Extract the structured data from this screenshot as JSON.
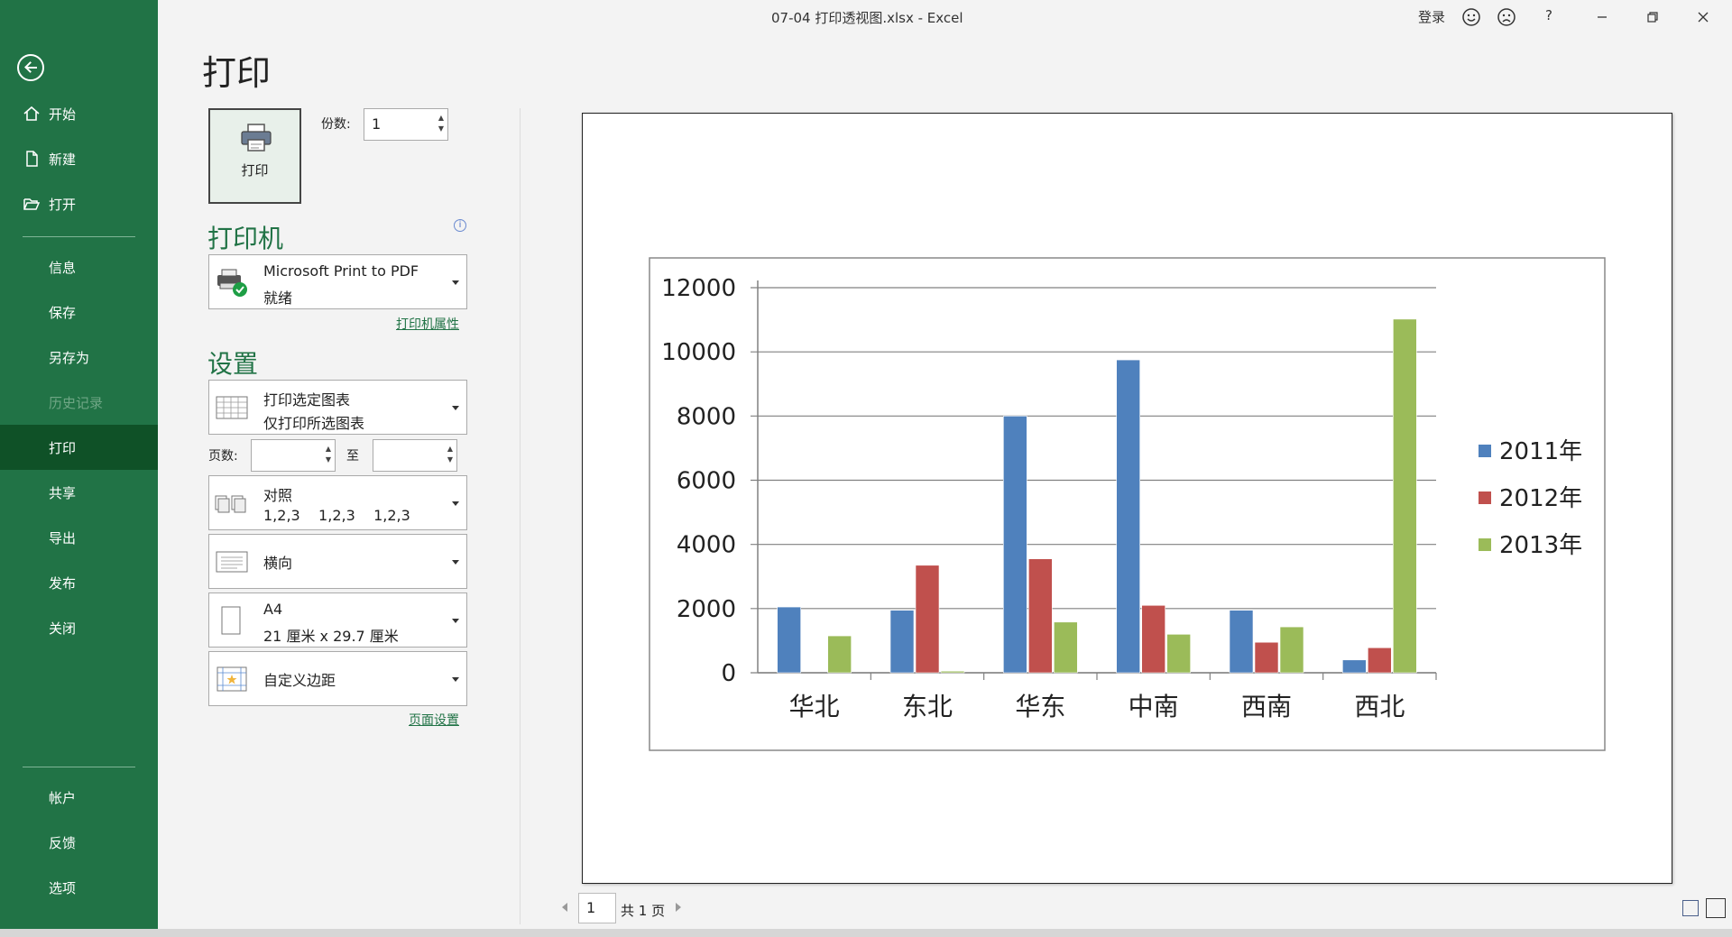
{
  "window": {
    "title": "07-04 打印透视图.xlsx  -  Excel",
    "signin_label": "登录",
    "help_label": "?"
  },
  "sidebar": {
    "items": [
      {
        "label": "开始",
        "icon": "home-icon"
      },
      {
        "label": "新建",
        "icon": "new-document-icon"
      },
      {
        "label": "打开",
        "icon": "open-folder-icon"
      },
      {
        "label": "信息"
      },
      {
        "label": "保存"
      },
      {
        "label": "另存为"
      },
      {
        "label": "历史记录",
        "disabled": true
      },
      {
        "label": "打印",
        "active": true
      },
      {
        "label": "共享"
      },
      {
        "label": "导出"
      },
      {
        "label": "发布"
      },
      {
        "label": "关闭"
      },
      {
        "label": "帐户"
      },
      {
        "label": "反馈"
      },
      {
        "label": "选项"
      }
    ]
  },
  "print": {
    "title": "打印",
    "print_button_label": "打印",
    "copies_label": "份数:",
    "copies_value": "1",
    "printer_heading": "打印机",
    "printer_name": "Microsoft Print to PDF",
    "printer_status": "就绪",
    "printer_properties_link": "打印机属性",
    "settings_heading": "设置",
    "print_what_line1": "打印选定图表",
    "print_what_line2": "仅打印所选图表",
    "pages_label": "页数:",
    "pages_to_label": "至",
    "collate_line1": "对照",
    "collate_line2": "1,2,3    1,2,3    1,2,3",
    "orientation": "横向",
    "paper_line1": "A4",
    "paper_line2": "21 厘米 x 29.7 厘米",
    "margins": "自定义边距",
    "page_setup_link": "页面设置"
  },
  "pager": {
    "current_page": "1",
    "total_label": "共 1 页"
  },
  "colors": {
    "brand_green": "#217346",
    "active_green": "#0f5127",
    "series_2011": "#4f81bd",
    "series_2012": "#c0504d",
    "series_2013": "#9bbb59"
  },
  "chart_data": {
    "type": "bar",
    "categories": [
      "华北",
      "东北",
      "华东",
      "中南",
      "西南",
      "西北"
    ],
    "series": [
      {
        "name": "2011年",
        "values": [
          2050,
          1950,
          8000,
          9750,
          1950,
          400
        ]
      },
      {
        "name": "2012年",
        "values": [
          0,
          3350,
          3550,
          2100,
          950,
          780
        ]
      },
      {
        "name": "2013年",
        "values": [
          1150,
          50,
          1580,
          1200,
          1430,
          11020
        ]
      }
    ],
    "ylim": [
      0,
      12000
    ],
    "yticks": [
      "0",
      "2000",
      "4000",
      "6000",
      "8000",
      "10000",
      "12000"
    ],
    "grid": true,
    "legend": "right"
  }
}
